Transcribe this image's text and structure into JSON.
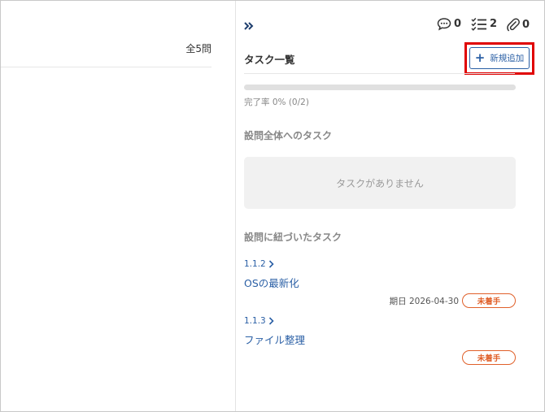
{
  "left": {
    "count_label": "全5問"
  },
  "toolbar": {
    "comments": "0",
    "tasks": "2",
    "attachments": "0"
  },
  "tasks": {
    "title": "タスク一覧",
    "add_button": "新規追加",
    "progress": {
      "text": "完了率 0% (0/2)",
      "percent": 0
    },
    "whole_section_title": "設問全体へのタスク",
    "empty_message": "タスクがありません",
    "linked_section_title": "設問に紐づいたタスク",
    "items": [
      {
        "ref": "1.1.2",
        "name": "OSの最新化",
        "due": "期日 2026-04-30",
        "status": "未着手"
      },
      {
        "ref": "1.1.3",
        "name": "ファイル整理",
        "due": "",
        "status": "未着手"
      }
    ]
  },
  "colors": {
    "accent": "#2a5fa5",
    "status": "#e0602a",
    "highlight": "#e00000"
  },
  "icons": [
    "collapse-chevrons-icon",
    "comment-icon",
    "checklist-icon",
    "paperclip-icon",
    "chevron-right-icon",
    "plus-icon"
  ]
}
